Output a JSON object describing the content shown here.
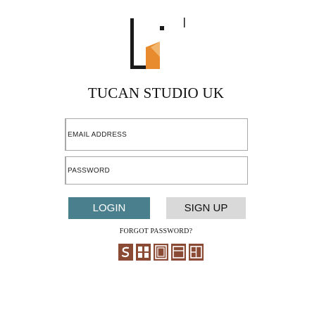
{
  "brand": {
    "title": "TUCAN STUDIO UK"
  },
  "form": {
    "email_placeholder": "EMAIL ADDRESS",
    "password_placeholder": "PASSWORD",
    "login_label": "LOGIN",
    "signup_label": "SIGN UP",
    "forgot_label": "FORGOT PASSWORD?"
  },
  "social": {
    "icons": [
      "skype-icon",
      "grid-icon",
      "box-icon",
      "window-icon",
      "layout-icon"
    ]
  },
  "colors": {
    "login_bg": "#4a7f8e",
    "signup_bg": "#d9d9d9",
    "social_icon": "#8a4a34",
    "logo_dark": "#1a1a1a",
    "logo_accent": "#e88a2e"
  }
}
